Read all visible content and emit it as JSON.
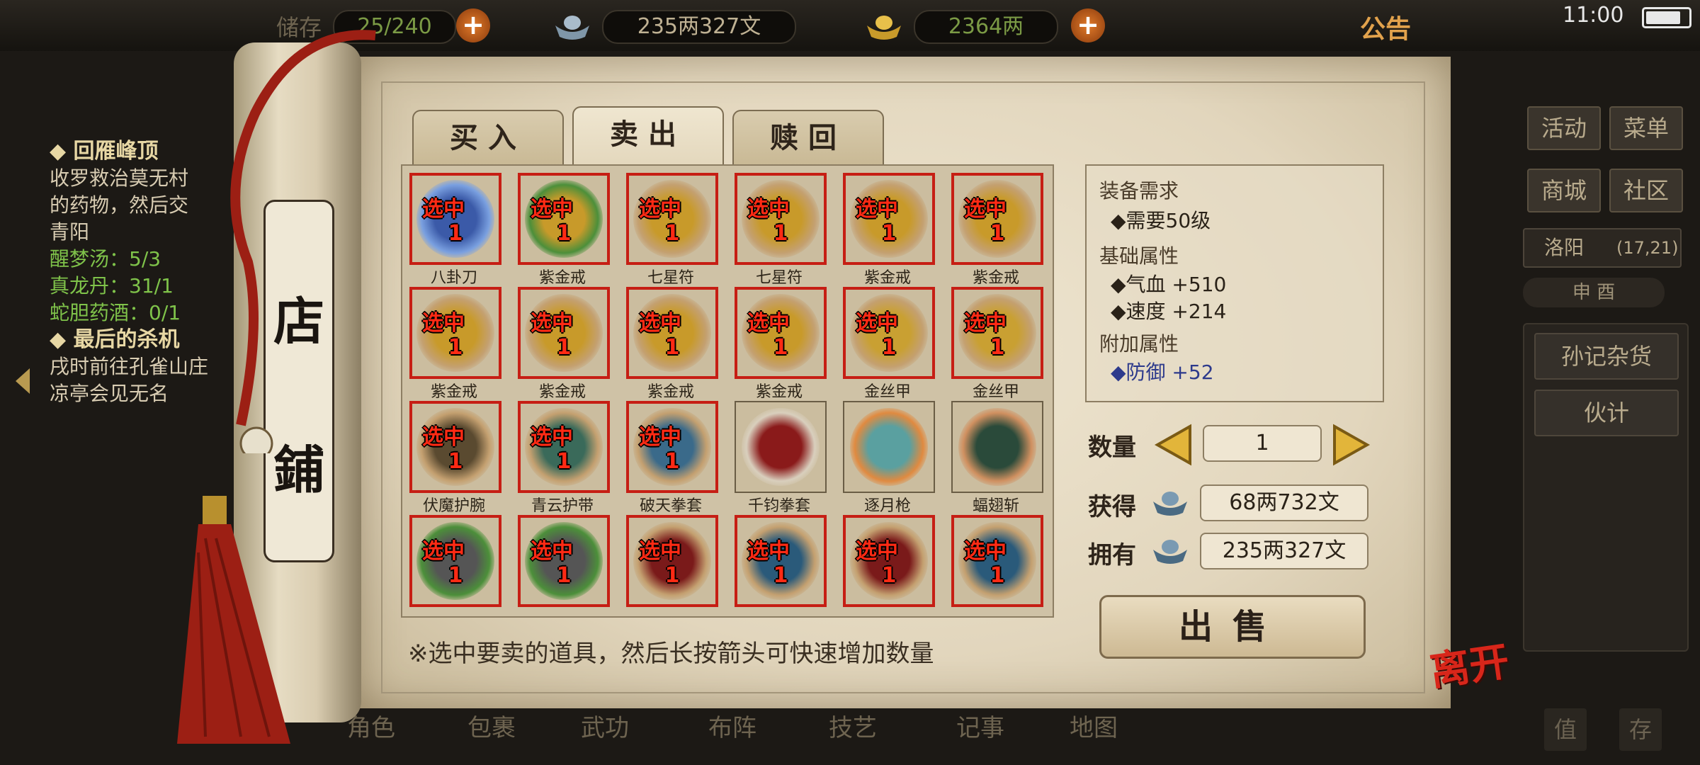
{
  "topbar": {
    "bag": "25/240",
    "bag_prefix": "储存",
    "money": "235两327文",
    "gold": "2364两",
    "notice": "公告",
    "time": "11:00"
  },
  "quest": {
    "q1_title": "◆ 回雁峰顶",
    "q1_line1": "收罗救治莫无村",
    "q1_line2": "的药物，然后交",
    "q1_line3": "青阳",
    "q1_item1": "醒梦汤：5/3",
    "q1_item2": "真龙丹：31/1",
    "q1_item3": "蛇胆药酒：0/1",
    "q2_title": "◆ 最后的杀机",
    "q2_line1": "戌时前往孔雀山庄",
    "q2_line2": "凉亭会见无名"
  },
  "side": {
    "activity": "活动",
    "menu": "菜单",
    "mall": "商城",
    "community": "社区",
    "location": "洛阳",
    "coords": "(17,21)",
    "compass": "申 酉",
    "shop_item1": "孙记杂货",
    "shop_item2": "伙计",
    "b1": "值",
    "b2": "存"
  },
  "bottom_nav": [
    "角色",
    "包裹",
    "武功",
    "布阵",
    "技艺",
    "记事",
    "地图"
  ],
  "scroll": {
    "char1": "店",
    "char2": "鋪"
  },
  "tabs": [
    {
      "label": "买入",
      "active": false
    },
    {
      "label": "卖出",
      "active": true
    },
    {
      "label": "赎回",
      "active": false
    }
  ],
  "selected_tag": "选中",
  "items": [
    {
      "name": "八卦刀",
      "sel": true,
      "qty": "1",
      "color": "#3b5aa8",
      "glow": "#7aa0e0"
    },
    {
      "name": "紫金戒",
      "sel": true,
      "qty": "1",
      "color": "#c89a2a",
      "glow": "#4c8f3a"
    },
    {
      "name": "七星符",
      "sel": true,
      "qty": "1",
      "color": "#c89a2a",
      "glow": "#c4a070"
    },
    {
      "name": "七星符",
      "sel": true,
      "qty": "1",
      "color": "#c89a2a",
      "glow": "#c4a070"
    },
    {
      "name": "紫金戒",
      "sel": true,
      "qty": "1",
      "color": "#c89a2a",
      "glow": "#c4a070"
    },
    {
      "name": "紫金戒",
      "sel": true,
      "qty": "1",
      "color": "#c89a2a",
      "glow": "#c4a070"
    },
    {
      "name": "紫金戒",
      "sel": true,
      "qty": "1",
      "color": "#c89a2a",
      "glow": "#c4a070"
    },
    {
      "name": "紫金戒",
      "sel": true,
      "qty": "1",
      "color": "#c89a2a",
      "glow": "#c4a070"
    },
    {
      "name": "紫金戒",
      "sel": true,
      "qty": "1",
      "color": "#c89a2a",
      "glow": "#c4a070"
    },
    {
      "name": "紫金戒",
      "sel": true,
      "qty": "1",
      "color": "#c89a2a",
      "glow": "#c4a070"
    },
    {
      "name": "金丝甲",
      "sel": true,
      "qty": "1",
      "color": "#c9a032",
      "glow": "#c4a070"
    },
    {
      "name": "金丝甲",
      "sel": true,
      "qty": "1",
      "color": "#c9a032",
      "glow": "#c4a070"
    },
    {
      "name": "伏魔护腕",
      "sel": true,
      "qty": "1",
      "color": "#5a4a30",
      "glow": "#c4a070"
    },
    {
      "name": "青云护带",
      "sel": true,
      "qty": "1",
      "color": "#3a6a5a",
      "glow": "#c4a070"
    },
    {
      "name": "破天拳套",
      "sel": true,
      "qty": "1",
      "color": "#3a6a8a",
      "glow": "#c4a070"
    },
    {
      "name": "千钧拳套",
      "sel": false,
      "qty": "",
      "color": "#8a1a1a",
      "glow": "#d9cfbd"
    },
    {
      "name": "逐月枪",
      "sel": false,
      "qty": "",
      "color": "#5aa0a0",
      "glow": "#e08a40"
    },
    {
      "name": "蝠翅斩",
      "sel": false,
      "qty": "",
      "color": "#2a4a3a",
      "glow": "#d09060"
    },
    {
      "name": "",
      "sel": true,
      "qty": "1",
      "color": "#555555",
      "glow": "#4c8f3a"
    },
    {
      "name": "",
      "sel": true,
      "qty": "1",
      "color": "#555555",
      "glow": "#4c8f3a"
    },
    {
      "name": "",
      "sel": true,
      "qty": "1",
      "color": "#7a1a1a",
      "glow": "#c4a070"
    },
    {
      "name": "",
      "sel": true,
      "qty": "1",
      "color": "#2a5a7a",
      "glow": "#c4a070"
    },
    {
      "name": "",
      "sel": true,
      "qty": "1",
      "color": "#7a1a1a",
      "glow": "#c4a070"
    },
    {
      "name": "",
      "sel": true,
      "qty": "1",
      "color": "#2a5a7a",
      "glow": "#c4a070"
    }
  ],
  "hint": "※选中要卖的道具，然后长按箭头可快速增加数量",
  "detail": {
    "req_title": "装备需求",
    "req_level": "◆需要50级",
    "base_title": "基础属性",
    "hp": "◆气血  +510",
    "speed": "◆速度  +214",
    "extra_title": "附加属性",
    "defense": "◆防御  +52"
  },
  "quantity_label": "数量",
  "quantity": "1",
  "gain_label": "获得",
  "gain": "68两732文",
  "own_label": "拥有",
  "own": "235两327文",
  "sell_button": "出售",
  "leave": "离开"
}
